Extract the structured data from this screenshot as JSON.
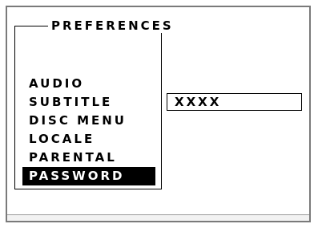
{
  "screen": {
    "title": "PREFERENCES",
    "menu": [
      {
        "label": "AUDIO",
        "selected": false
      },
      {
        "label": "SUBTITLE",
        "selected": false
      },
      {
        "label": "DISC MENU",
        "selected": false
      },
      {
        "label": "LOCALE",
        "selected": false
      },
      {
        "label": "PARENTAL",
        "selected": false
      },
      {
        "label": "PASSWORD",
        "selected": true
      }
    ],
    "value_field": "XXXX"
  },
  "colors": {
    "background": "#ffffff",
    "text": "#000000",
    "highlight_bg": "#000000",
    "highlight_text": "#ffffff",
    "frame": "#7a7a7a"
  }
}
